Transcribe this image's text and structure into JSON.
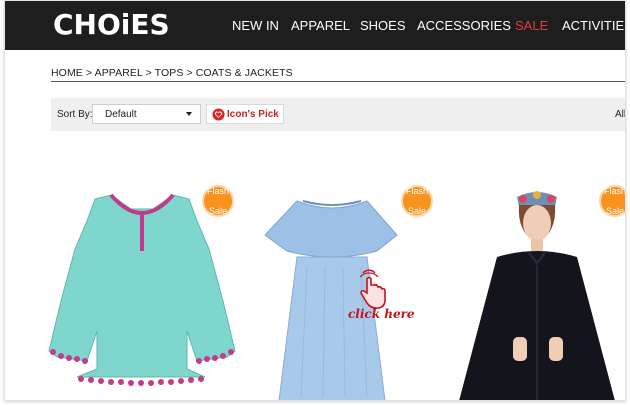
{
  "header": {
    "logo": "CHOiES",
    "nav": [
      {
        "label": "NEW IN",
        "sale": false
      },
      {
        "label": "APPAREL",
        "sale": false
      },
      {
        "label": "SHOES",
        "sale": false
      },
      {
        "label": "ACCESSORIES",
        "sale": false
      },
      {
        "label": "SALE",
        "sale": true
      },
      {
        "label": "ACTIVITIES",
        "sale": false
      }
    ]
  },
  "breadcrumb": "HOME > APPAREL > TOPS > COATS & JACKETS",
  "toolbar": {
    "sort_label": "Sort By:",
    "sort_value": "Default",
    "pick_label": "Icon's Pick",
    "all_label": "All"
  },
  "products": [
    {
      "name": "mint-green-tassel-cape-dress",
      "badge_line1": "Flash",
      "badge_line2": "Sale"
    },
    {
      "name": "light-blue-ruffle-off-shoulder-dress",
      "badge_line1": "Flash",
      "badge_line2": "Sale"
    },
    {
      "name": "black-cape-coat",
      "badge_line1": "Flash",
      "badge_line2": "Sale"
    }
  ],
  "annotation": {
    "click_text": "click here"
  },
  "colors": {
    "header_bg": "#1e1e1e",
    "sale": "#e23b3b",
    "badge": "#f7931e",
    "pick_red": "#c0262c",
    "click_red": "#c4121a"
  }
}
